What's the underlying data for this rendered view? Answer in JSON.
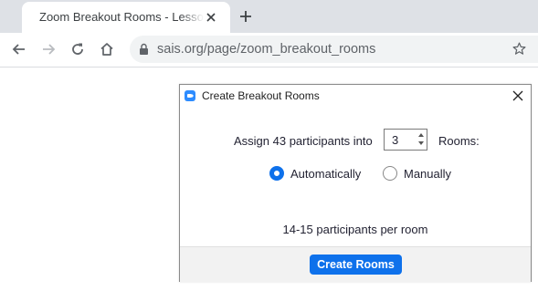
{
  "browser": {
    "tab_title": "Zoom Breakout Rooms - Lessons",
    "url": "sais.org/page/zoom_breakout_rooms"
  },
  "icons": {
    "tab_close": "close-icon",
    "new_tab": "plus-icon",
    "back": "arrow-left-icon",
    "forward": "arrow-right-icon",
    "reload": "reload-icon",
    "home": "home-icon",
    "lock": "lock-icon",
    "bookmark": "star-icon",
    "dialog_close": "close-icon",
    "app": "zoom-logo-icon"
  },
  "dialog": {
    "title": "Create Breakout Rooms",
    "assign_label": "Assign 43 participants into",
    "room_count": "3",
    "rooms_label": "Rooms:",
    "options": [
      {
        "label": "Automatically",
        "selected": true
      },
      {
        "label": "Manually",
        "selected": false
      }
    ],
    "per_room_text": "14-15 participants per room",
    "create_button": "Create Rooms"
  },
  "colors": {
    "accent": "#0e71eb",
    "zoom_logo": "#2d8cff",
    "tabstrip": "#dee1e6",
    "omnibox": "#f1f3f4"
  }
}
